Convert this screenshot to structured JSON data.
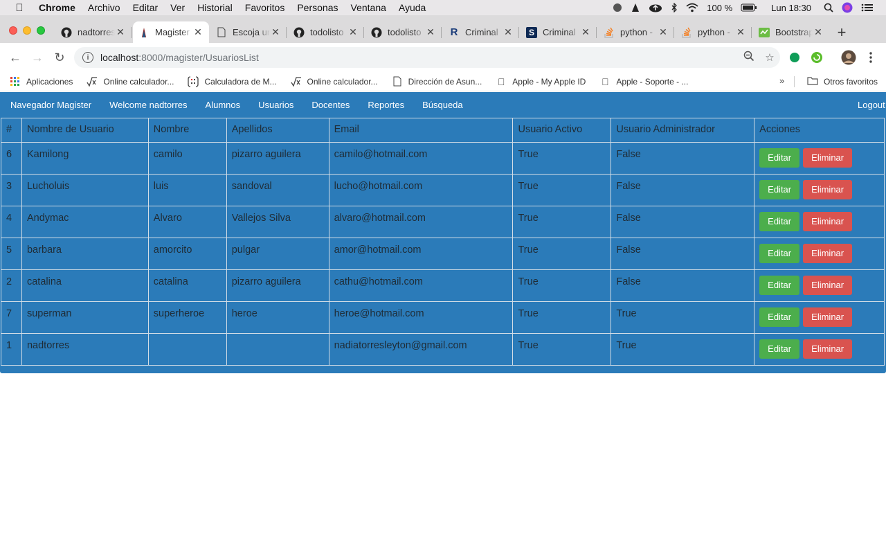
{
  "menubar": {
    "app": "Chrome",
    "items": [
      "Archivo",
      "Editar",
      "Ver",
      "Historial",
      "Favoritos",
      "Personas",
      "Ventana",
      "Ayuda"
    ],
    "battery": "100 %",
    "clock": "Lun 18:30"
  },
  "tabs": [
    {
      "title": "nadtorres",
      "icon": "github-icon"
    },
    {
      "title": "Magister",
      "icon": "django-icon",
      "active": true
    },
    {
      "title": "Escoja un",
      "icon": "document-icon"
    },
    {
      "title": "todolisto",
      "icon": "github-icon"
    },
    {
      "title": "todolisto",
      "icon": "github-icon"
    },
    {
      "title": "Criminal",
      "icon": "r-icon"
    },
    {
      "title": "Criminal",
      "icon": "s-icon"
    },
    {
      "title": "python -",
      "icon": "stackoverflow-icon"
    },
    {
      "title": "python -",
      "icon": "stackoverflow-icon"
    },
    {
      "title": "Bootstrap",
      "icon": "bootstrap-icon"
    }
  ],
  "omnibox": {
    "host": "localhost",
    "path": ":8000/magister/UsuariosList"
  },
  "bookmarks": [
    {
      "label": "Aplicaciones",
      "icon": "apps-grid-icon"
    },
    {
      "label": "Online calculador...",
      "icon": "sqrt-icon"
    },
    {
      "label": "Calculadora de M...",
      "icon": "calculator-icon"
    },
    {
      "label": "Online calculador...",
      "icon": "sqrt-icon"
    },
    {
      "label": "Dirección de Asun...",
      "icon": "document-icon"
    },
    {
      "label": "Apple - My Apple ID",
      "icon": "apple-icon"
    },
    {
      "label": "Apple - Soporte - ...",
      "icon": "apple-icon"
    }
  ],
  "bookmarks_other": "Otros favoritos",
  "nav": {
    "brand": "Navegador Magister",
    "links": [
      "Welcome nadtorres",
      "Alumnos",
      "Usuarios",
      "Docentes",
      "Reportes",
      "Búsqueda"
    ],
    "logout": "Logout"
  },
  "table": {
    "headers": [
      "#",
      "Nombre de Usuario",
      "Nombre",
      "Apellidos",
      "Email",
      "Usuario Activo",
      "Usuario Administrador",
      "Acciones"
    ],
    "rows": [
      [
        "6",
        "Kamilong",
        "camilo",
        "pizarro aguilera",
        "camilo@hotmail.com",
        "True",
        "False"
      ],
      [
        "3",
        "Lucholuis",
        "luis",
        "sandoval",
        "lucho@hotmail.com",
        "True",
        "False"
      ],
      [
        "4",
        "Andymac",
        "Alvaro",
        "Vallejos Silva",
        "alvaro@hotmail.com",
        "True",
        "False"
      ],
      [
        "5",
        "barbara",
        "amorcito",
        "pulgar",
        "amor@hotmail.com",
        "True",
        "False"
      ],
      [
        "2",
        "catalina",
        "catalina",
        "pizarro aguilera",
        "cathu@hotmail.com",
        "True",
        "False"
      ],
      [
        "7",
        "superman",
        "superheroe",
        "heroe",
        "heroe@hotmail.com",
        "True",
        "True"
      ],
      [
        "1",
        "nadtorres",
        "",
        "",
        "nadiatorresleyton@gmail.com",
        "True",
        "True"
      ]
    ],
    "edit_label": "Editar",
    "delete_label": "Eliminar"
  },
  "colors": {
    "navbar": "#2b7bb9",
    "edit": "#4cae4c",
    "delete": "#d9534f"
  }
}
